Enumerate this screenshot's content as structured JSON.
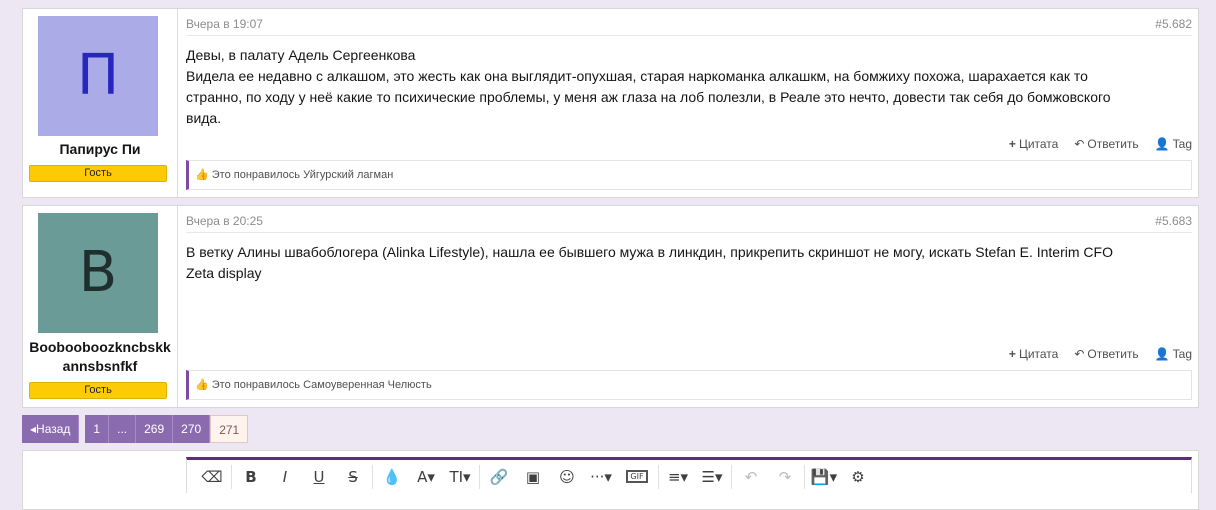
{
  "posts": [
    {
      "avatar_letter": "П",
      "avatar_bg": "#ababe8",
      "avatar_fg": "#2727bd",
      "username": "Папирус Пи",
      "role": "Гость",
      "date": "Вчера в 19:07",
      "number": "#5.682",
      "lines": [
        "Девы, в палату Адель Сергеенкова",
        "Видела ее недавно с алкашом, это жесть как она выглядит-опухшая, старая наркоманка алкашкм, на бомжиху похожа, шарахается как то",
        "странно, по ходу у неё какие то психические проблемы, у меня аж глаза на лоб полезли, в Реале это нечто, довести так себя до бомжовского",
        "вида."
      ],
      "likes": "Это понравилось Уйгурский лагман"
    },
    {
      "avatar_letter": "B",
      "avatar_bg": "#6a9b97",
      "avatar_fg": "#1f2f2e",
      "username": "Boobooboozkncbskkannsbsnfkf",
      "role": "Гость",
      "date": "Вчера в 20:25",
      "number": "#5.683",
      "lines": [
        "В ветку Алины швабоблогера (Alinka Lifestyle), нашла ее бывшего мужа в линкдин, прикрепить скриншот не могу, искать Stefan E. Interim CFO",
        "Zeta display"
      ],
      "likes": "Это понравилось Самоуверенная Челюсть"
    }
  ],
  "actions": {
    "quote": "Цитата",
    "reply": "Ответить",
    "tag": "Tag"
  },
  "pagination": {
    "prev": "Назад",
    "first": "1",
    "ellipsis": "...",
    "pages": [
      "269",
      "270"
    ],
    "current": "271"
  },
  "editor_toolbar": [
    {
      "name": "eraser-icon",
      "glyph": "⌫"
    },
    {
      "name": "bold-icon",
      "glyph": "B"
    },
    {
      "name": "italic-icon",
      "glyph": "I"
    },
    {
      "name": "underline-icon",
      "glyph": "U"
    },
    {
      "name": "strikethrough-icon",
      "glyph": "S"
    },
    {
      "name": "color-drop-icon",
      "glyph": "💧"
    },
    {
      "name": "font-family-icon",
      "glyph": "A▾"
    },
    {
      "name": "font-size-icon",
      "glyph": "TI▾"
    },
    {
      "name": "link-icon",
      "glyph": "🔗"
    },
    {
      "name": "image-icon",
      "glyph": "▣"
    },
    {
      "name": "smiley-icon",
      "glyph": "☺"
    },
    {
      "name": "more-icon",
      "glyph": "···▾"
    },
    {
      "name": "gif-icon",
      "glyph": "GIF"
    },
    {
      "name": "align-icon",
      "glyph": "≡▾"
    },
    {
      "name": "list-icon",
      "glyph": "☰▾"
    },
    {
      "name": "undo-icon",
      "glyph": "↶"
    },
    {
      "name": "redo-icon",
      "glyph": "↷"
    },
    {
      "name": "save-draft-icon",
      "glyph": "💾▾"
    },
    {
      "name": "settings-icon",
      "glyph": "⚙"
    }
  ],
  "colors": {
    "accent": "#5a2d82",
    "badge": "#fccb06",
    "page_bg": "#ece7f2"
  }
}
